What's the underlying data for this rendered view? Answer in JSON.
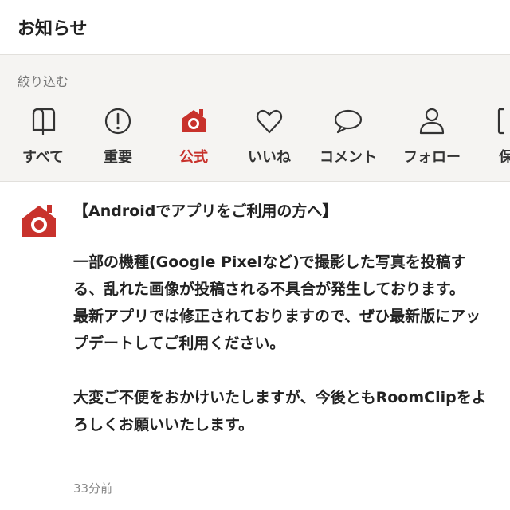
{
  "header": {
    "title": "お知らせ"
  },
  "filter": {
    "label": "絞り込む",
    "tabs": [
      {
        "label": "すべて",
        "icon": "mailbox-icon"
      },
      {
        "label": "重要",
        "icon": "exclamation-icon"
      },
      {
        "label": "公式",
        "icon": "official-roomclip-icon",
        "active": true
      },
      {
        "label": "いいね",
        "icon": "heart-icon"
      },
      {
        "label": "コメント",
        "icon": "speech-bubble-icon"
      },
      {
        "label": "フォロー",
        "icon": "person-icon"
      },
      {
        "label": "保",
        "icon": "bookmark-icon"
      }
    ]
  },
  "notice": {
    "title": "【Androidでアプリをご利用の方へ】",
    "body": "一部の機種(Google Pixelなど)で撮影した写真を投稿する、乱れた画像が投稿される不具合が発生しております。\n最新アプリでは修正されておりますので、ぜひ最新版にアップデートしてご利用ください。\n\n大変ご不便をおかけいたしますが、今後ともRoomClipをよろしくお願いいたします。",
    "time": "33分前"
  },
  "colors": {
    "accent": "#c8322c",
    "filter_bg": "#f5f4f2"
  }
}
